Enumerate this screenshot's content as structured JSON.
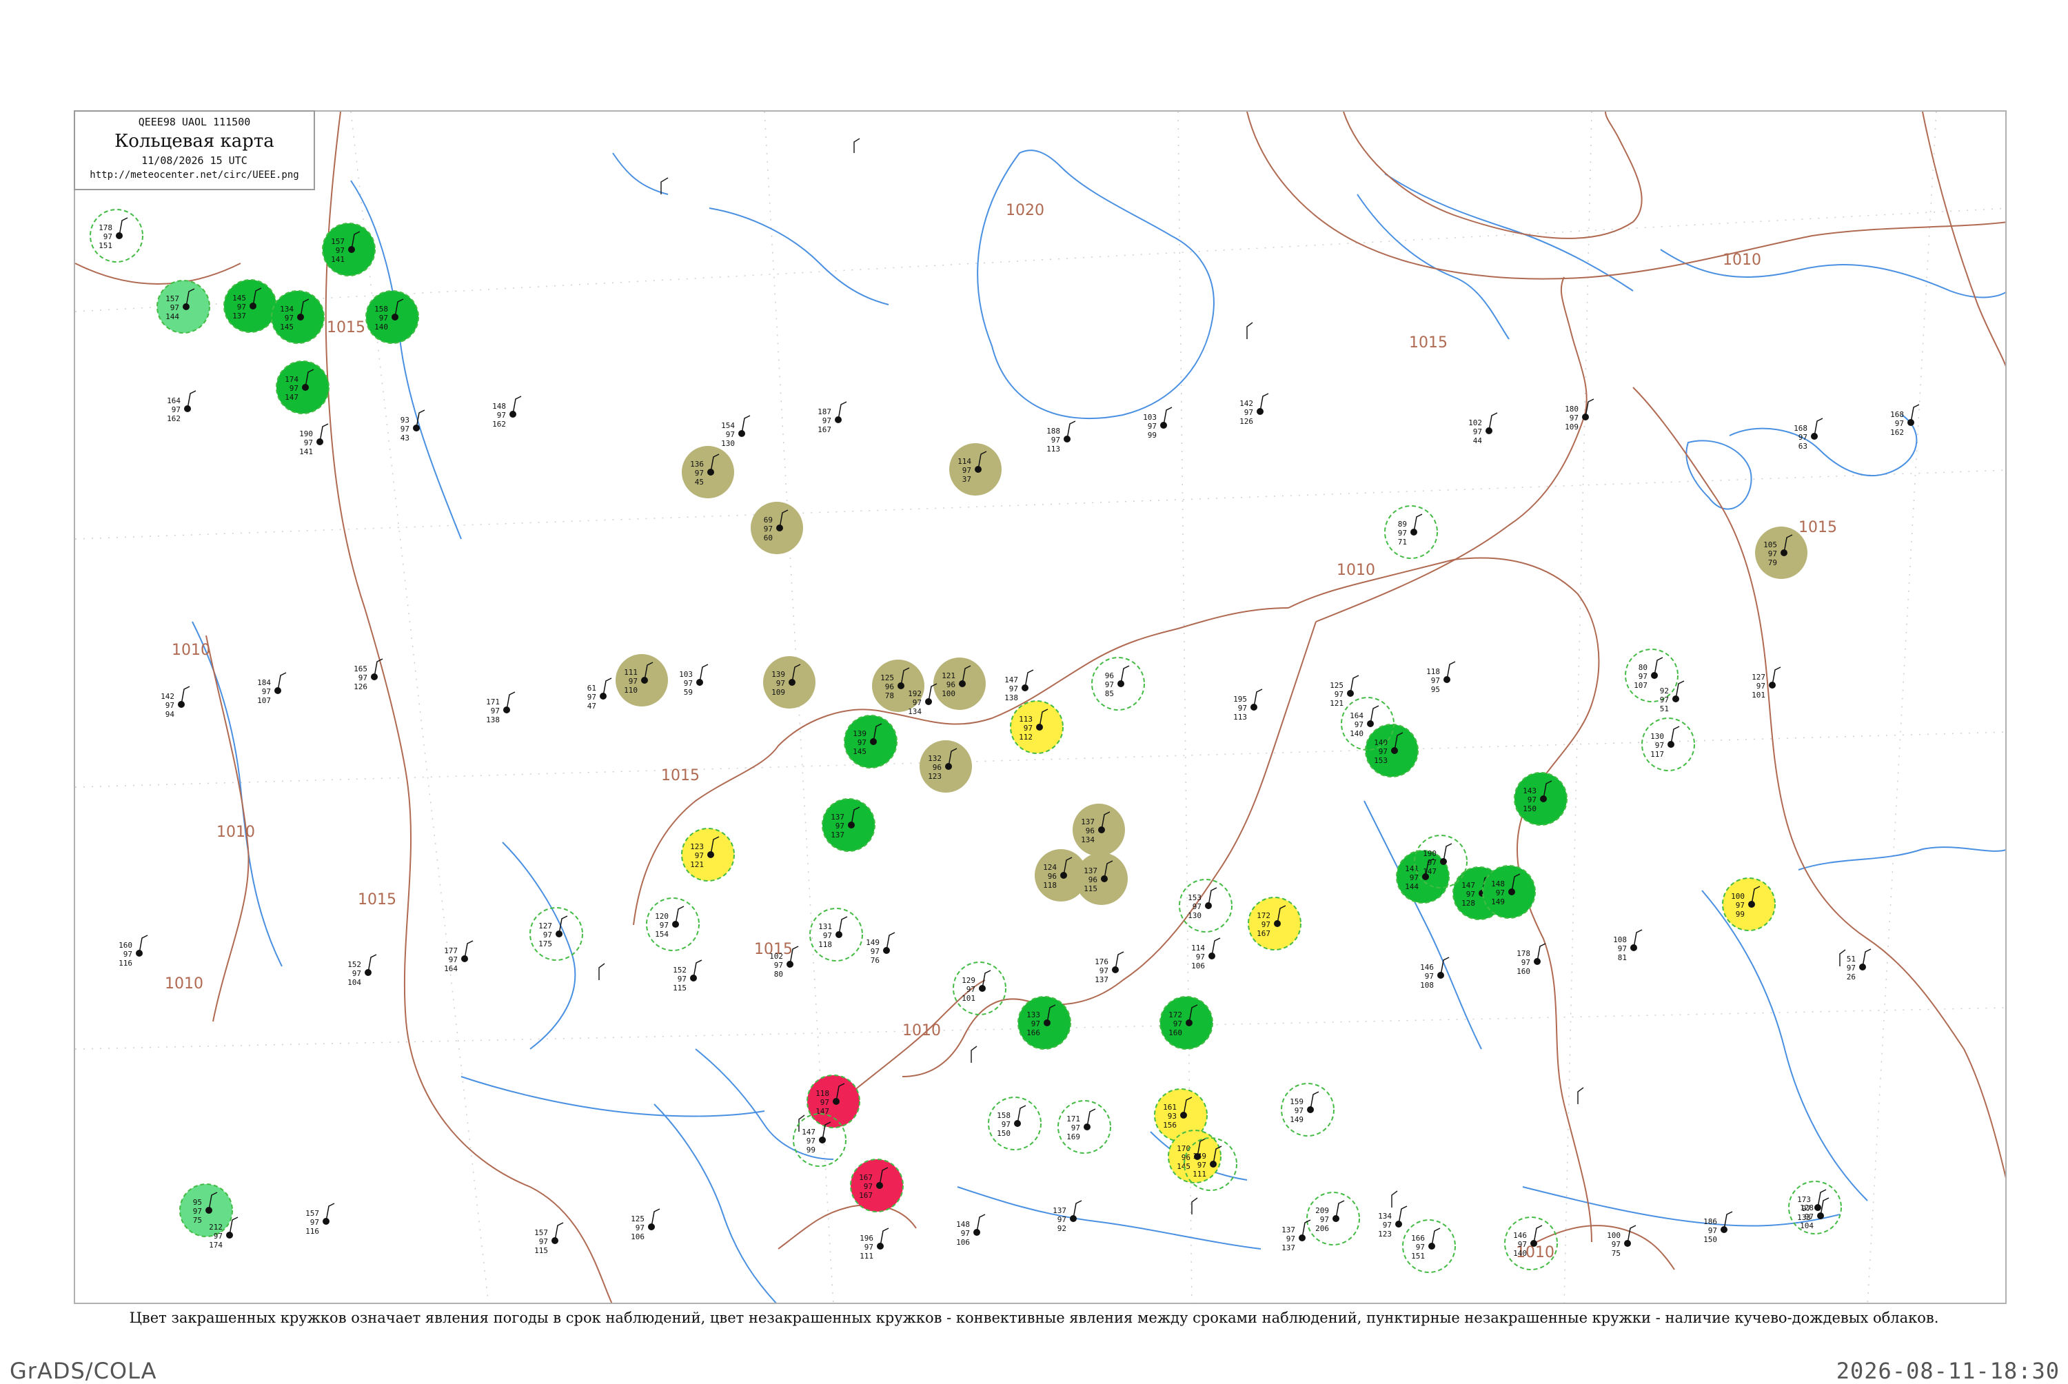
{
  "header": {
    "code": "QEEE98  UAOL  111500",
    "title": "Кольцевая карта",
    "datetime": "11/08/2026 15 UTC",
    "url": "http://meteocenter.net/circ/UEEE.png"
  },
  "caption": "Цвет закрашенных кружков означает явления погоды в срок наблюдений, цвет незакрашенных кружков - конвективные явления между сроками наблюдений, пунктирные незакрашенные кружки - наличие кучево-дождевых облаков.",
  "footer": {
    "left": "GrADS/COLA",
    "right": "2026-08-11-18:30"
  },
  "colors": {
    "isobar": "#b06a52",
    "river": "#4a90e2",
    "rain": "#11bb33",
    "shower_light": "#66dd88",
    "fog_haze": "#b8b478",
    "thunder_warn": "#ffee44",
    "thunderstorm": "#ee2255",
    "cb_dashed": "#44bb44"
  },
  "isobar_labels": [
    {
      "text": "1020"
    },
    {
      "text": "1015"
    },
    {
      "text": "1015"
    },
    {
      "text": "1015"
    },
    {
      "text": "1015"
    },
    {
      "text": "1015"
    },
    {
      "text": "1015"
    },
    {
      "text": "1010"
    },
    {
      "text": "1010"
    },
    {
      "text": "1010"
    },
    {
      "text": "1010"
    },
    {
      "text": "1010"
    },
    {
      "text": "1010"
    },
    {
      "text": "1005"
    },
    {
      "text": "1010"
    }
  ],
  "stations": [
    {
      "kind": "rain",
      "p": "173",
      "t": "97",
      "td": "107"
    },
    {
      "kind": "rain",
      "p": "157",
      "t": "97",
      "td": "141"
    },
    {
      "kind": "rain",
      "p": "158",
      "t": "97",
      "td": "140"
    },
    {
      "kind": "rain",
      "p": "145",
      "t": "97",
      "td": "137"
    },
    {
      "kind": "rain",
      "p": "134",
      "t": "97",
      "td": "145"
    },
    {
      "kind": "rain",
      "p": "174",
      "t": "97",
      "td": "147"
    },
    {
      "kind": "shower",
      "p": "157",
      "t": "97",
      "td": "144"
    },
    {
      "kind": "shower",
      "p": "95",
      "t": "97",
      "td": "75"
    },
    {
      "kind": "fog",
      "p": "136",
      "t": "97",
      "td": "45"
    },
    {
      "kind": "fog",
      "p": "69",
      "t": "97",
      "td": "60"
    },
    {
      "kind": "fog",
      "p": "114",
      "t": "97",
      "td": "37"
    },
    {
      "kind": "fog",
      "p": "111",
      "t": "97",
      "td": "110"
    },
    {
      "kind": "fog",
      "p": "139",
      "t": "97",
      "td": "109"
    },
    {
      "kind": "fog",
      "p": "125",
      "t": "96",
      "td": "78"
    },
    {
      "kind": "fog",
      "p": "121",
      "t": "96",
      "td": "100"
    },
    {
      "kind": "fog",
      "p": "132",
      "t": "96",
      "td": "123"
    },
    {
      "kind": "fog",
      "p": "137",
      "t": "96",
      "td": "134"
    },
    {
      "kind": "fog",
      "p": "124",
      "t": "96",
      "td": "118"
    },
    {
      "kind": "fog",
      "p": "137",
      "t": "96",
      "td": "115"
    },
    {
      "kind": "fog",
      "p": "105",
      "t": "97",
      "td": "79"
    },
    {
      "kind": "warn",
      "p": "113",
      "t": "97",
      "td": "112"
    },
    {
      "kind": "warn",
      "p": "123",
      "t": "97",
      "td": "121"
    },
    {
      "kind": "warn",
      "p": "172",
      "t": "97",
      "td": "167"
    },
    {
      "kind": "warn",
      "p": "161",
      "t": "93",
      "td": "156"
    },
    {
      "kind": "warn",
      "p": "170",
      "t": "96",
      "td": "145"
    },
    {
      "kind": "warn",
      "p": "100",
      "t": "97",
      "td": "99"
    },
    {
      "kind": "rain",
      "p": "139",
      "t": "97",
      "td": "145"
    },
    {
      "kind": "rain",
      "p": "137",
      "t": "97",
      "td": "137"
    },
    {
      "kind": "rain",
      "p": "140",
      "t": "97",
      "td": "153"
    },
    {
      "kind": "rain",
      "p": "141",
      "t": "97",
      "td": "144"
    },
    {
      "kind": "rain",
      "p": "147",
      "t": "97",
      "td": "128"
    },
    {
      "kind": "rain",
      "p": "148",
      "t": "97",
      "td": "149"
    },
    {
      "kind": "rain",
      "p": "143",
      "t": "97",
      "td": "150"
    },
    {
      "kind": "rain",
      "p": "133",
      "t": "97",
      "td": "166"
    },
    {
      "kind": "rain",
      "p": "172",
      "t": "97",
      "td": "160"
    },
    {
      "kind": "thunder",
      "p": "118",
      "t": "97",
      "td": "147"
    },
    {
      "kind": "thunder",
      "p": "167",
      "t": "97",
      "td": "167"
    },
    {
      "kind": "cb",
      "p": "178",
      "t": "97",
      "td": "151"
    },
    {
      "kind": "cb",
      "p": "120",
      "t": "97",
      "td": "154"
    },
    {
      "kind": "cb",
      "p": "127",
      "t": "97",
      "td": "175"
    },
    {
      "kind": "cb",
      "p": "131",
      "t": "97",
      "td": "118"
    },
    {
      "kind": "cb",
      "p": "147",
      "t": "97",
      "td": "99"
    },
    {
      "kind": "cb",
      "p": "158",
      "t": "97",
      "td": "150"
    },
    {
      "kind": "cb",
      "p": "171",
      "t": "97",
      "td": "169"
    },
    {
      "kind": "cb",
      "p": "129",
      "t": "97",
      "td": "101"
    },
    {
      "kind": "cb",
      "p": "153",
      "t": "97",
      "td": "130"
    },
    {
      "kind": "cb",
      "p": "159",
      "t": "97",
      "td": "149"
    },
    {
      "kind": "cb",
      "p": "209",
      "t": "97",
      "td": "206"
    },
    {
      "kind": "cb",
      "p": "146",
      "t": "97",
      "td": "140"
    },
    {
      "kind": "cb",
      "p": "166",
      "t": "97",
      "td": "151"
    },
    {
      "kind": "cb",
      "p": "190",
      "t": "97",
      "td": "147"
    },
    {
      "kind": "cb",
      "p": "96",
      "t": "97",
      "td": "85"
    },
    {
      "kind": "cb",
      "p": "89",
      "t": "97",
      "td": "71"
    },
    {
      "kind": "cb",
      "p": "164",
      "t": "97",
      "td": "140"
    },
    {
      "kind": "cb",
      "p": "80",
      "t": "97",
      "td": "107"
    },
    {
      "kind": "cb",
      "p": "130",
      "t": "97",
      "td": "117"
    },
    {
      "kind": "cb",
      "p": "173",
      "t": "97",
      "td": "133"
    },
    {
      "kind": "cb",
      "p": "149",
      "t": "97",
      "td": "111"
    },
    {
      "kind": "plain",
      "p": "162",
      "t": "97",
      "td": "146"
    },
    {
      "kind": "plain",
      "p": "190",
      "t": "97",
      "td": "141"
    },
    {
      "kind": "plain",
      "p": "171",
      "t": "97",
      "td": "138"
    },
    {
      "kind": "plain",
      "p": "152",
      "t": "97",
      "td": "115"
    },
    {
      "kind": "plain",
      "p": "196",
      "t": "97",
      "td": "111"
    },
    {
      "kind": "plain",
      "p": "188",
      "t": "97",
      "td": "113"
    },
    {
      "kind": "plain",
      "p": "195",
      "t": "97",
      "td": "113"
    },
    {
      "kind": "plain",
      "p": "146",
      "t": "97",
      "td": "108"
    },
    {
      "kind": "plain",
      "p": "100",
      "t": "97",
      "td": "75"
    },
    {
      "kind": "plain",
      "p": "168",
      "t": "97",
      "td": "63"
    },
    {
      "kind": "plain",
      "p": "142",
      "t": "97",
      "td": "94"
    },
    {
      "kind": "plain",
      "p": "152",
      "t": "97",
      "td": "104"
    },
    {
      "kind": "plain",
      "p": "157",
      "t": "97",
      "td": "115"
    },
    {
      "kind": "plain",
      "p": "154",
      "t": "97",
      "td": "130"
    },
    {
      "kind": "plain",
      "p": "192",
      "t": "97",
      "td": "134"
    },
    {
      "kind": "plain",
      "p": "176",
      "t": "97",
      "td": "137"
    },
    {
      "kind": "plain",
      "p": "137",
      "t": "97",
      "td": "137"
    },
    {
      "kind": "plain",
      "p": "102",
      "t": "97",
      "td": "44"
    },
    {
      "kind": "plain",
      "p": "92",
      "t": "97",
      "td": "51"
    },
    {
      "kind": "plain",
      "p": "51",
      "t": "97",
      "td": "26"
    },
    {
      "kind": "plain",
      "p": "212",
      "t": "97",
      "td": "174"
    },
    {
      "kind": "plain",
      "p": "93",
      "t": "97",
      "td": "43"
    },
    {
      "kind": "plain",
      "p": "61",
      "t": "97",
      "td": "47"
    },
    {
      "kind": "plain",
      "p": "102",
      "t": "97",
      "td": "80"
    },
    {
      "kind": "plain",
      "p": "148",
      "t": "97",
      "td": "106"
    },
    {
      "kind": "plain",
      "p": "103",
      "t": "97",
      "td": "99"
    },
    {
      "kind": "plain",
      "p": "125",
      "t": "97",
      "td": "121"
    },
    {
      "kind": "plain",
      "p": "178",
      "t": "97",
      "td": "160"
    },
    {
      "kind": "plain",
      "p": "186",
      "t": "97",
      "td": "150"
    },
    {
      "kind": "plain",
      "p": "168",
      "t": "97",
      "td": "162"
    },
    {
      "kind": "plain",
      "p": "184",
      "t": "97",
      "td": "107"
    },
    {
      "kind": "plain",
      "p": "177",
      "t": "97",
      "td": "164"
    },
    {
      "kind": "plain",
      "p": "125",
      "t": "97",
      "td": "106"
    },
    {
      "kind": "plain",
      "p": "187",
      "t": "97",
      "td": "167"
    },
    {
      "kind": "plain",
      "p": "147",
      "t": "97",
      "td": "138"
    },
    {
      "kind": "plain",
      "p": "114",
      "t": "97",
      "td": "106"
    },
    {
      "kind": "plain",
      "p": "134",
      "t": "97",
      "td": "123"
    },
    {
      "kind": "plain",
      "p": "180",
      "t": "97",
      "td": "109"
    },
    {
      "kind": "plain",
      "p": "127",
      "t": "97",
      "td": "101"
    },
    {
      "kind": "plain",
      "p": "160",
      "t": "97",
      "td": "116"
    },
    {
      "kind": "plain",
      "p": "157",
      "t": "97",
      "td": "116"
    },
    {
      "kind": "plain",
      "p": "148",
      "t": "97",
      "td": "162"
    },
    {
      "kind": "plain",
      "p": "103",
      "t": "97",
      "td": "59"
    },
    {
      "kind": "plain",
      "p": "149",
      "t": "97",
      "td": "76"
    },
    {
      "kind": "plain",
      "p": "137",
      "t": "97",
      "td": "92"
    },
    {
      "kind": "plain",
      "p": "142",
      "t": "97",
      "td": "126"
    },
    {
      "kind": "plain",
      "p": "118",
      "t": "97",
      "td": "95"
    },
    {
      "kind": "plain",
      "p": "108",
      "t": "97",
      "td": "81"
    },
    {
      "kind": "plain",
      "p": "128",
      "t": "97",
      "td": "104"
    },
    {
      "kind": "plain",
      "p": "164",
      "t": "97",
      "td": "162"
    },
    {
      "kind": "plain",
      "p": "165",
      "t": "97",
      "td": "126"
    }
  ]
}
